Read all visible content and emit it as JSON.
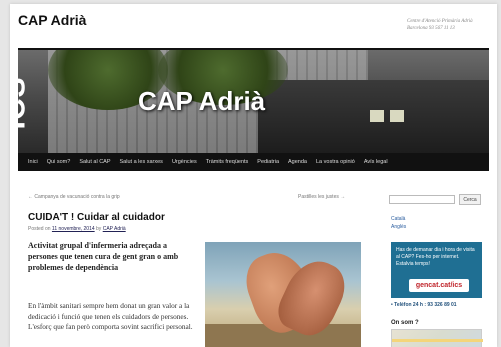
{
  "site": {
    "title": "CAP Adrià",
    "address_line1": "Centre d'Atenció Primària Adrià",
    "address_line2": "Barcelona 93 567 11 13"
  },
  "banner": {
    "logo_text": "ICS",
    "title": "CAP Adrià"
  },
  "nav": {
    "items": [
      "Inici",
      "Qui som?",
      "Salut al CAP",
      "Salut a les xarxes",
      "Urgències",
      "Tràmits freqüents",
      "Pediatria",
      "Agenda",
      "La vostra opinió",
      "Avís legal"
    ]
  },
  "post_nav": {
    "prev": "← Campanya de vacunació contra la grip",
    "next": "Pastilles les justes →"
  },
  "post": {
    "title": "CUIDA'T ! Cuidar al cuidador",
    "meta_prefix": "Posted on",
    "date": "11 novembre, 2014",
    "meta_by": "by",
    "author": "CAP Adrià",
    "lead": "Activitat grupal d'infermeria adreçada a persones que tenen cura de gent gran o amb problemes de dependència",
    "body": "En l'àmbit sanitari sempre hem donat un gran valor a la dedicació i funció que tenen els cuidadors de persones. L'esforç que fan però comporta sovint sacrifici personal."
  },
  "sidebar": {
    "search_placeholder": "",
    "search_button": "Cerca",
    "languages": [
      "Català",
      "Anglès"
    ],
    "promo_text": "Has de demanar dia i hora de visita al CAP? Fes-ho per internet. Estalvia temps!",
    "promo_logo": "gencat.cat/ics",
    "phone": "• Telèfon 24 h : 93 326 89 01",
    "where_title": "On som ?"
  }
}
